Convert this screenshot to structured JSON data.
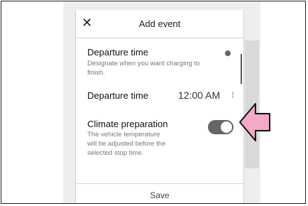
{
  "dialog": {
    "title": "Add event",
    "close_icon": "close-icon"
  },
  "departure_section": {
    "title": "Departure time",
    "description": "Designate when you want charging to finish.",
    "status_dot": "status-dot"
  },
  "departure_time_row": {
    "label": "Departure time",
    "value": "12:00 AM",
    "menu_icon": "kebab-menu-icon"
  },
  "climate_section": {
    "title": "Climate preparation",
    "description": "The vehicle temperature will be adjusted before the selected stop time.",
    "toggle_state": "on"
  },
  "footer": {
    "save_label": "Save"
  },
  "annotation": {
    "arrow_color": "#f4a9c6",
    "arrow_icon": "pointer-arrow-icon"
  }
}
